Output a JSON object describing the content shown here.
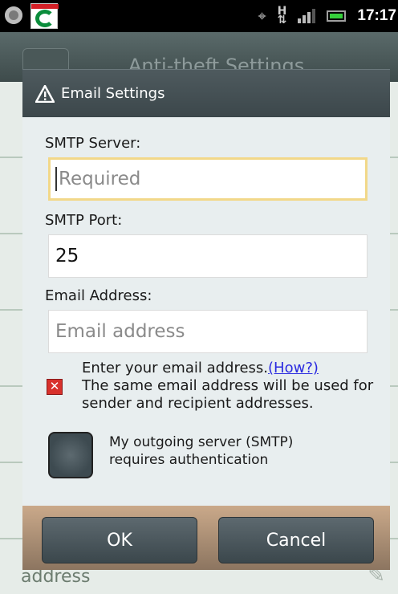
{
  "status_bar": {
    "time": "17:17",
    "network": "H"
  },
  "background": {
    "title": "Anti-theft Settings",
    "bottom_text": "address"
  },
  "dialog": {
    "title": "Email Settings",
    "smtp_server": {
      "label": "SMTP Server:",
      "value": "",
      "placeholder": "Required"
    },
    "smtp_port": {
      "label": "SMTP Port:",
      "value": "25"
    },
    "email_address": {
      "label": "Email Address:",
      "value": "",
      "placeholder": "Email address"
    },
    "error": {
      "line1": "Enter your email address.",
      "link": "(How?)",
      "line2": "The same email address will be used for sender and recipient addresses."
    },
    "auth_checkbox": {
      "label_line1": "My outgoing server (SMTP)",
      "label_line2": "requires authentication",
      "checked": false
    },
    "buttons": {
      "ok": "OK",
      "cancel": "Cancel"
    }
  }
}
